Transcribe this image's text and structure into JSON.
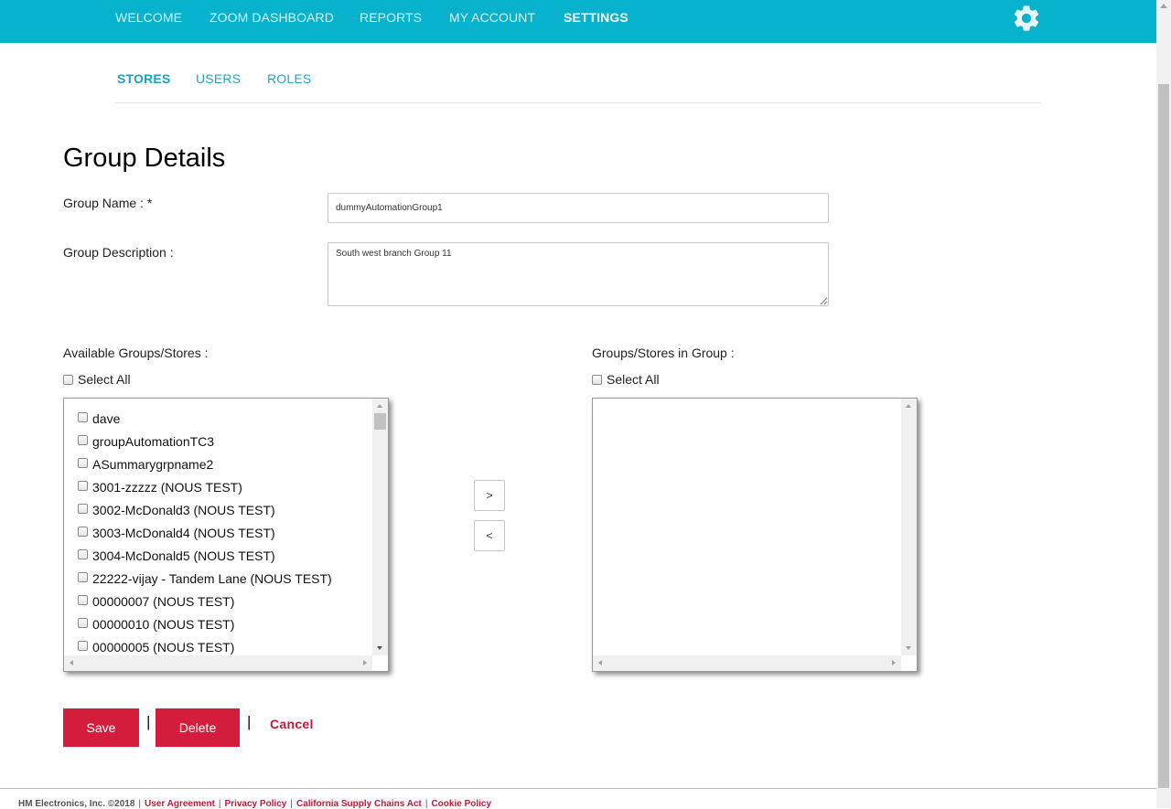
{
  "top_nav": {
    "items": [
      {
        "label": "WELCOME",
        "active": false
      },
      {
        "label": "ZOOM DASHBOARD",
        "active": false
      },
      {
        "label": "REPORTS",
        "active": false
      },
      {
        "label": "MY ACCOUNT",
        "active": false
      },
      {
        "label": "SETTINGS",
        "active": true
      }
    ],
    "gear_icon": "gear-icon",
    "background_color": "#06b2cc"
  },
  "sub_nav": {
    "items": [
      {
        "label": "STORES",
        "active": true
      },
      {
        "label": "USERS",
        "active": false
      },
      {
        "label": "ROLES",
        "active": false
      }
    ]
  },
  "page_title": "Group Details",
  "form": {
    "group_name_label": "Group Name : *",
    "group_name_value": "dummyAutomationGroup1",
    "group_description_label": "Group Description :",
    "group_description_value": "South west branch Group 11"
  },
  "available": {
    "label": "Available Groups/Stores :",
    "select_all_label": "Select All",
    "items": [
      "dave",
      "groupAutomationTC3",
      "ASummarygrpname2",
      "3001-zzzzz (NOUS TEST)",
      "3002-McDonald3 (NOUS TEST)",
      "3003-McDonald4 (NOUS TEST)",
      "3004-McDonald5 (NOUS TEST)",
      "22222-vijay - Tandem Lane (NOUS TEST)",
      "00000007 (NOUS TEST)",
      "00000010 (NOUS TEST)",
      "00000005 (NOUS TEST)"
    ]
  },
  "in_group": {
    "label": "Groups/Stores in Group :",
    "select_all_label": "Select All",
    "items": []
  },
  "move_buttons": {
    "add_label": ">",
    "remove_label": "<"
  },
  "actions": {
    "save_label": "Save",
    "delete_label": "Delete",
    "cancel_label": "Cancel",
    "separator": "|",
    "button_color": "#d41c3c"
  },
  "footer": {
    "copyright": "HM Electronics, Inc. ©2018",
    "links": [
      "User Agreement",
      "Privacy Policy",
      "California Supply Chains Act",
      "Cookie Policy"
    ],
    "separator": "|",
    "link_color": "#c8163a"
  }
}
